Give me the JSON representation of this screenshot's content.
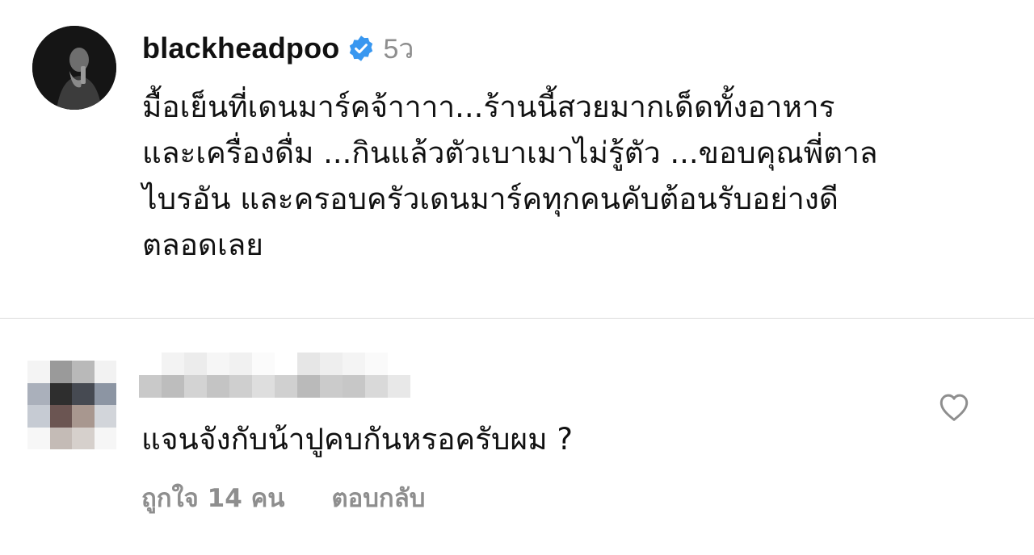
{
  "post": {
    "username": "blackheadpoo",
    "time_ago": "5ว",
    "verified": true,
    "caption": "มื้อเย็นที่เดนมาร์คจ้าาาา...ร้านนี้สวยมากเด็ดทั้งอาหาร\nและเครื่องดื่ม ...กินแล้วตัวเบาเมาไม่รู้ตัว ...ขอบคุณพี่ตาล\nไบรอัน และครอบครัวเดนมาร์คทุกคนคับต้อนรับอย่างดี\nตลอดเลย"
  },
  "comment": {
    "text": "แจนจังกับน้าปูคบกันหรอครับผม ?",
    "likes_label": "ถูกใจ 14 คน",
    "reply_label": "ตอบกลับ"
  },
  "icons": {
    "verified": "verified-badge-icon",
    "like": "heart-icon"
  },
  "colors": {
    "verified_blue": "#3897f0",
    "meta_gray": "#8e8e8e",
    "divider": "#dbdbdb"
  }
}
